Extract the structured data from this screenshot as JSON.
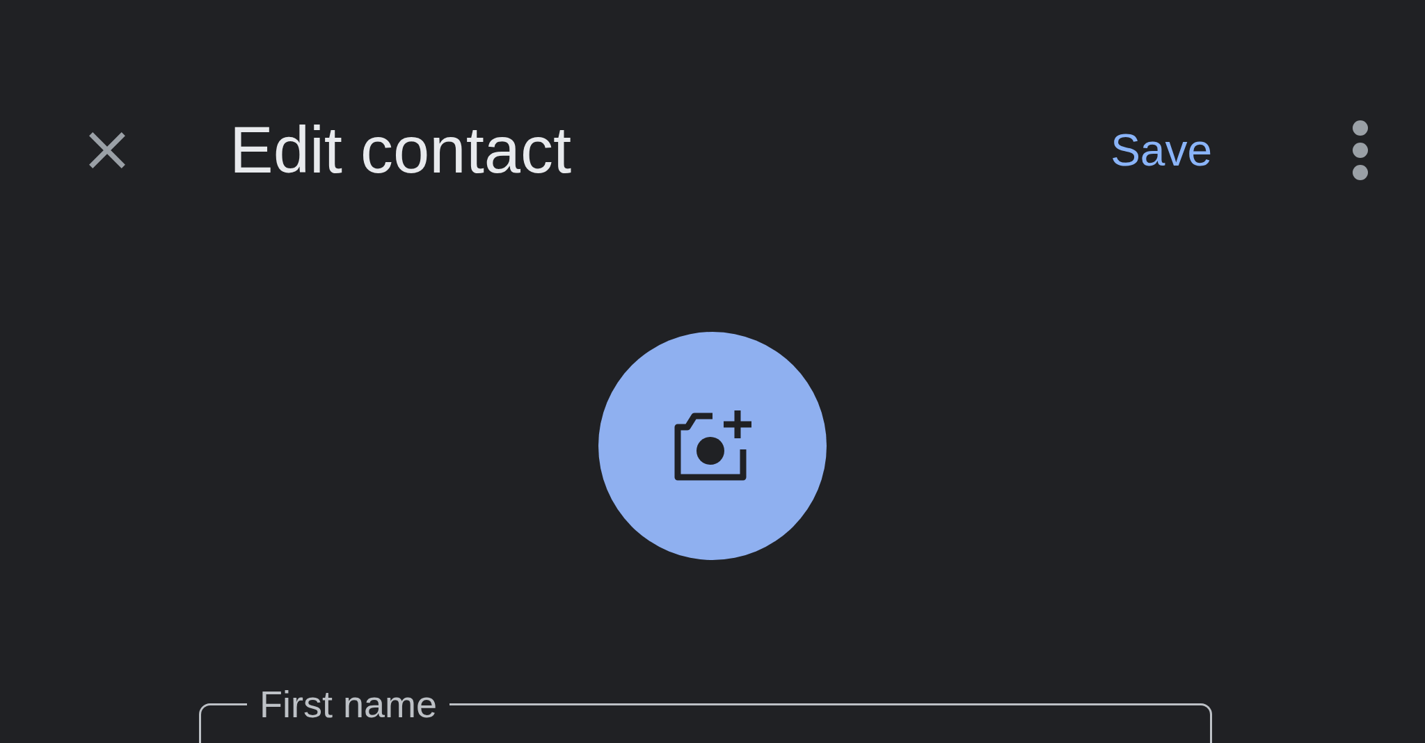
{
  "header": {
    "title": "Edit contact",
    "save_label": "Save"
  },
  "fields": [
    {
      "label": "First name"
    }
  ]
}
